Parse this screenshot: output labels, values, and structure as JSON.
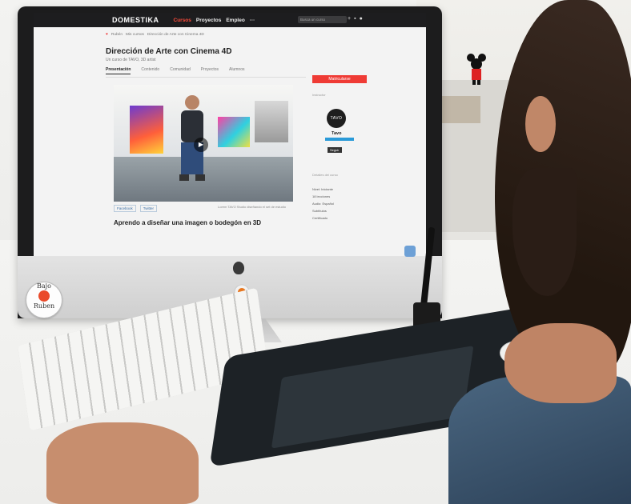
{
  "site": {
    "brand": "DOMESTIKA",
    "nav": [
      "Cursos",
      "Proyectos",
      "Empleo",
      "···"
    ],
    "search_placeholder": "Busca un curso"
  },
  "breadcrumb": [
    "Rubén",
    "Mis cursos",
    "Dirección de Arte con Cinema 4D"
  ],
  "course": {
    "title": "Dirección de Arte con Cinema 4D",
    "subtitle": "Un curso de TAVO, 3D artist",
    "tabs": [
      "Presentación",
      "Contenido",
      "Comunidad",
      "Proyectos",
      "Alumnos"
    ],
    "buy_label": "Matricularse",
    "share": [
      "Facebook",
      "Twitter"
    ],
    "caption": "Lorem TAVO Studio diseñando el set de estudio",
    "section_heading": "Aprendo a diseñar una imagen o bodegón en 3D"
  },
  "instructor": {
    "section_label": "Instructor",
    "logo_text": "TAVO",
    "name": "Tavo",
    "follow_label": "Seguir"
  },
  "sidebar": {
    "detail_label": "Detalles del curso",
    "features": [
      "Nivel: Iniciante",
      "18 lecciones",
      "Audio: Español",
      "Subtítulos",
      "Certificado"
    ]
  },
  "sticker": {
    "line1": "Bajo",
    "line2": "Ruben"
  },
  "colors": {
    "accent": "#ef3b35",
    "nav_bg": "#1d1d1f",
    "link": "#3a6ea5"
  }
}
